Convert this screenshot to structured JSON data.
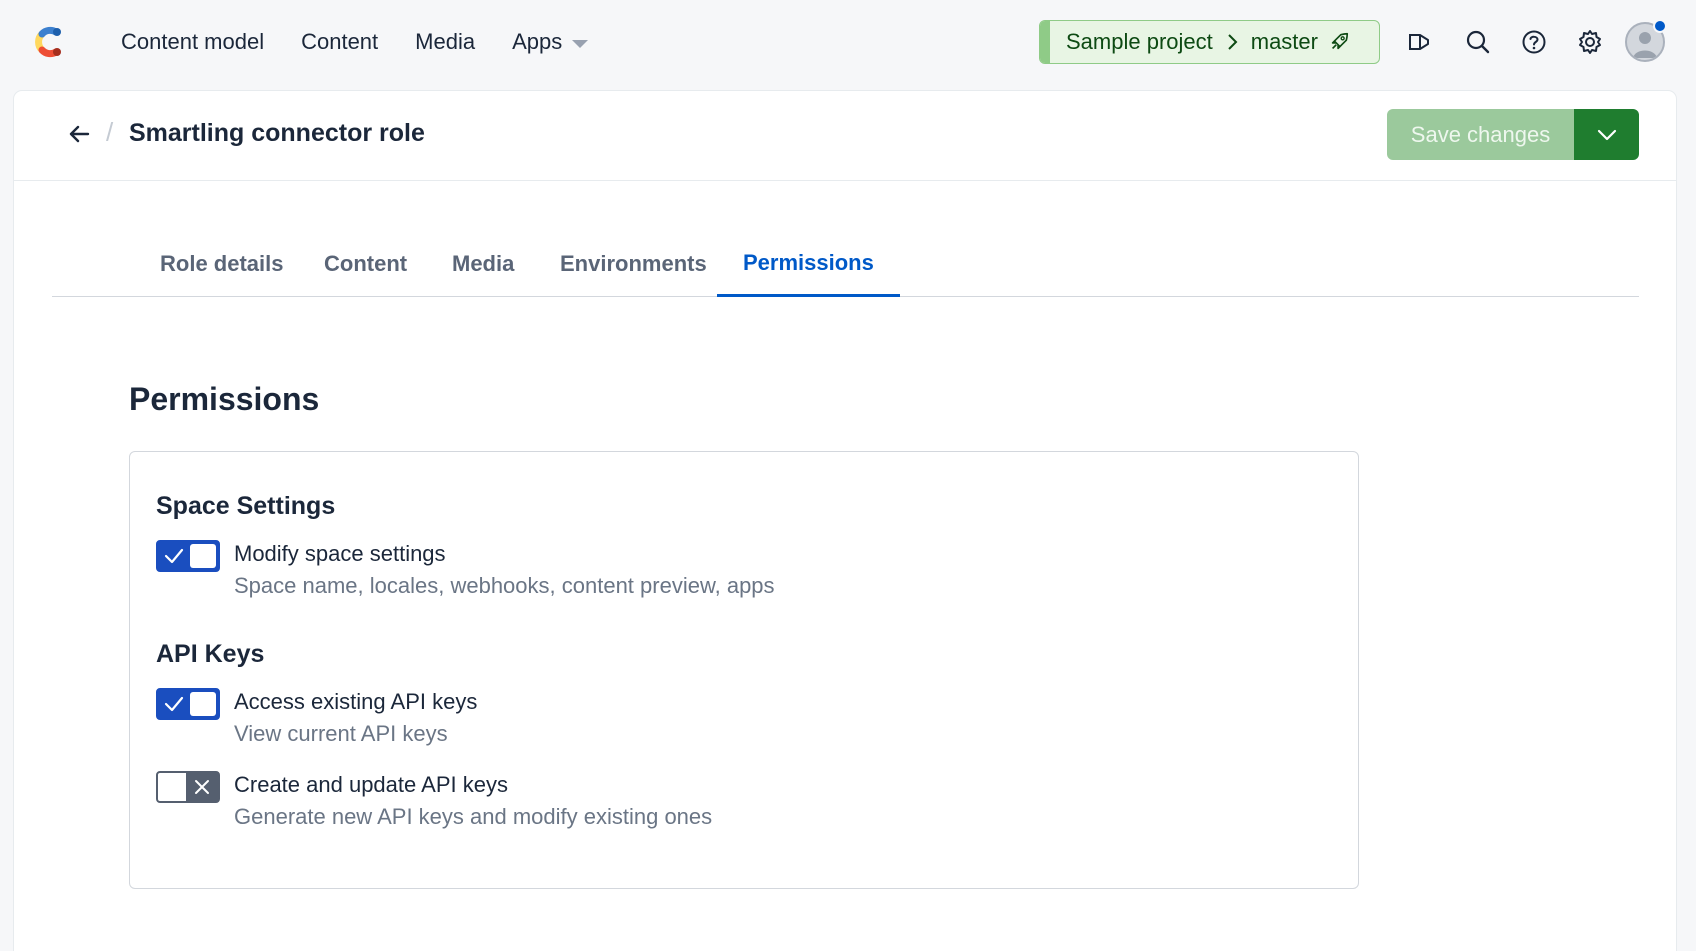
{
  "topnav": {
    "items": [
      {
        "label": "Content model"
      },
      {
        "label": "Content"
      },
      {
        "label": "Media"
      },
      {
        "label": "Apps"
      }
    ],
    "env": {
      "space": "Sample project",
      "environment": "master"
    },
    "icons": [
      "announcement-icon",
      "search-icon",
      "help-icon",
      "settings-icon",
      "avatar"
    ]
  },
  "header": {
    "title": "Smartling connector role",
    "save_label": "Save changes"
  },
  "tabs": [
    {
      "label": "Role details"
    },
    {
      "label": "Content"
    },
    {
      "label": "Media"
    },
    {
      "label": "Environments"
    },
    {
      "label": "Permissions",
      "active": true
    }
  ],
  "main": {
    "section_title": "Permissions",
    "groups": [
      {
        "title": "Space Settings",
        "permissions": [
          {
            "label": "Modify space settings",
            "description": "Space name, locales, webhooks, content preview, apps",
            "enabled": true
          }
        ]
      },
      {
        "title": "API Keys",
        "permissions": [
          {
            "label": "Access existing API keys",
            "description": "View current API keys",
            "enabled": true
          },
          {
            "label": "Create and update API keys",
            "description": "Generate new API keys and modify existing ones",
            "enabled": false
          }
        ]
      }
    ]
  },
  "colors": {
    "accent": "#0059c8",
    "toggle_on": "#1a4ebf",
    "save_disabled": "#9bc99c",
    "save_dropdown": "#1f7d2f",
    "env_bg": "#e8f5e4"
  }
}
